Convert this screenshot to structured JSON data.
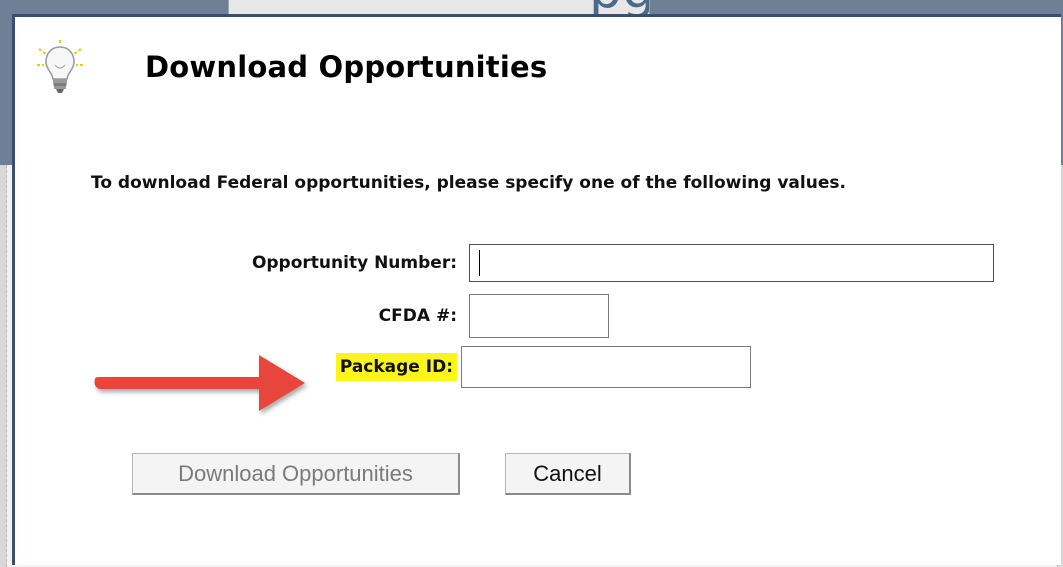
{
  "background": {
    "banner_text": "pg"
  },
  "dialog": {
    "title": "Download Opportunities",
    "icon": "lightbulb-icon",
    "instructions": "To download Federal opportunities, please specify one of the following values.",
    "fields": {
      "opportunity_number": {
        "label": "Opportunity Number:",
        "value": "",
        "placeholder": ""
      },
      "cfda": {
        "label": "CFDA #:",
        "value": "",
        "placeholder": ""
      },
      "package_id": {
        "label": "Package ID:",
        "value": "",
        "placeholder": "",
        "highlighted": true
      }
    },
    "buttons": {
      "download_label": "Download Opportunities",
      "download_enabled": false,
      "cancel_label": "Cancel"
    }
  },
  "annotation": {
    "arrow_color": "#e8453c",
    "highlight_color": "#fbf51c"
  }
}
